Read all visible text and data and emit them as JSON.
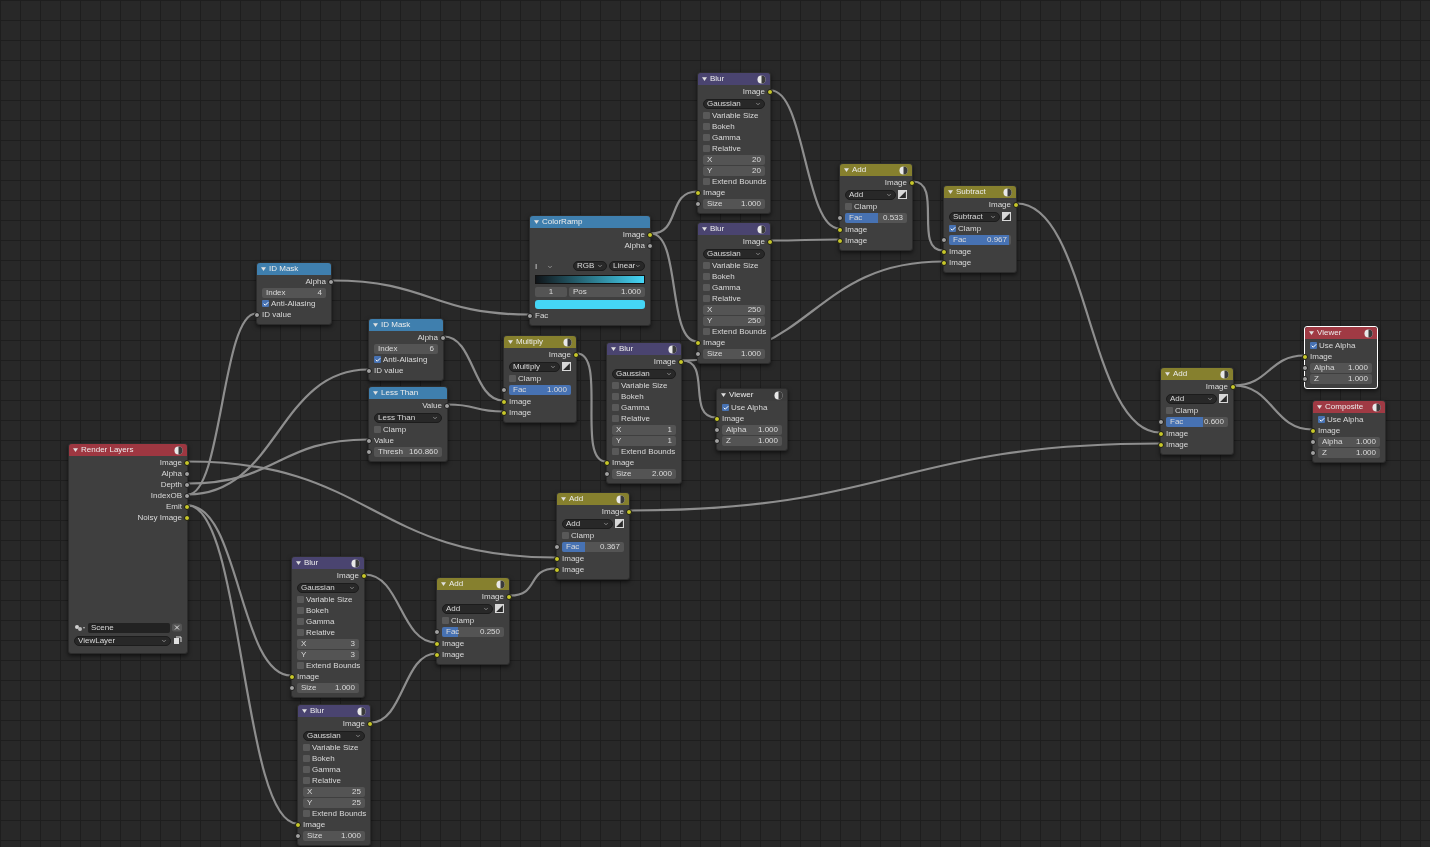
{
  "nodes": [
    {
      "title": "Render Layers",
      "kind": "input",
      "selected": false,
      "preview_icon": true,
      "rows": [
        {
          "kind": "output",
          "label": "Image",
          "socket": {
            "kind": "color"
          }
        },
        {
          "kind": "output",
          "label": "Alpha",
          "socket": {
            "kind": "value"
          }
        },
        {
          "kind": "output",
          "label": "Depth",
          "socket": {
            "kind": "value"
          }
        },
        {
          "kind": "output",
          "label": "IndexOB",
          "socket": {
            "kind": "value"
          }
        },
        {
          "kind": "output",
          "label": "Emit",
          "socket": {
            "kind": "color"
          }
        },
        {
          "kind": "output",
          "label": "Noisy Image",
          "socket": {
            "kind": "color"
          }
        },
        {
          "kind": "scene",
          "value": "Scene"
        },
        {
          "kind": "layer",
          "value": "ViewLayer"
        }
      ]
    },
    {
      "title": "ID Mask",
      "kind": "matte",
      "selected": false,
      "preview_icon": false,
      "rows": [
        {
          "kind": "output",
          "label": "Alpha",
          "socket": {
            "kind": "value"
          }
        },
        {
          "kind": "field",
          "label": "Index",
          "value": "4"
        },
        {
          "kind": "checkbox",
          "label": "Anti-Aliasing",
          "checked": true
        },
        {
          "kind": "input",
          "label": "ID value",
          "socket": {
            "kind": "value"
          }
        }
      ]
    },
    {
      "title": "Blur",
      "kind": "filter",
      "selected": false,
      "preview_icon": true,
      "rows": [
        {
          "kind": "output",
          "label": "Image",
          "socket": {
            "kind": "color"
          }
        },
        {
          "kind": "select",
          "value": "Gaussian"
        },
        {
          "kind": "checkbox",
          "label": "Variable Size",
          "checked": false
        },
        {
          "kind": "checkbox",
          "label": "Bokeh",
          "checked": false
        },
        {
          "kind": "checkbox",
          "label": "Gamma",
          "checked": false
        },
        {
          "kind": "checkbox",
          "label": "Relative",
          "checked": false
        },
        {
          "kind": "field",
          "label": "X",
          "value": "3"
        },
        {
          "kind": "field",
          "label": "Y",
          "value": "3"
        },
        {
          "kind": "checkbox",
          "label": "Extend Bounds",
          "checked": false
        },
        {
          "kind": "input",
          "label": "Image",
          "socket": {
            "kind": "color"
          }
        },
        {
          "kind": "field",
          "label": "Size",
          "value": "1.000",
          "socket": {
            "kind": "value"
          }
        }
      ]
    },
    {
      "title": "Blur",
      "kind": "filter",
      "selected": false,
      "preview_icon": true,
      "rows": [
        {
          "kind": "output",
          "label": "Image",
          "socket": {
            "kind": "color"
          }
        },
        {
          "kind": "select",
          "value": "Gaussian"
        },
        {
          "kind": "checkbox",
          "label": "Variable Size",
          "checked": false
        },
        {
          "kind": "checkbox",
          "label": "Bokeh",
          "checked": false
        },
        {
          "kind": "checkbox",
          "label": "Gamma",
          "checked": false
        },
        {
          "kind": "checkbox",
          "label": "Relative",
          "checked": false
        },
        {
          "kind": "field",
          "label": "X",
          "value": "25"
        },
        {
          "kind": "field",
          "label": "Y",
          "value": "25"
        },
        {
          "kind": "checkbox",
          "label": "Extend Bounds",
          "checked": false
        },
        {
          "kind": "input",
          "label": "Image",
          "socket": {
            "kind": "color"
          }
        },
        {
          "kind": "field",
          "label": "Size",
          "value": "1.000",
          "socket": {
            "kind": "value"
          }
        }
      ]
    },
    {
      "title": "ID Mask",
      "kind": "matte",
      "selected": false,
      "preview_icon": false,
      "rows": [
        {
          "kind": "output",
          "label": "Alpha",
          "socket": {
            "kind": "value"
          }
        },
        {
          "kind": "field",
          "label": "Index",
          "value": "6"
        },
        {
          "kind": "checkbox",
          "label": "Anti-Aliasing",
          "checked": true
        },
        {
          "kind": "input",
          "label": "ID value",
          "socket": {
            "kind": "value"
          }
        }
      ]
    },
    {
      "title": "Less Than",
      "kind": "converter",
      "selected": false,
      "preview_icon": false,
      "rows": [
        {
          "kind": "output",
          "label": "Value",
          "socket": {
            "kind": "value"
          }
        },
        {
          "kind": "select",
          "value": "Less Than"
        },
        {
          "kind": "checkbox",
          "label": "Clamp",
          "checked": false
        },
        {
          "kind": "input",
          "label": "Value",
          "socket": {
            "kind": "value"
          }
        },
        {
          "kind": "field",
          "label": "Thresh",
          "value": "160.860",
          "socket": {
            "kind": "value"
          }
        }
      ]
    },
    {
      "title": "Add",
      "kind": "color",
      "selected": false,
      "preview_icon": true,
      "rows": [
        {
          "kind": "output",
          "label": "Image",
          "socket": {
            "kind": "color"
          }
        },
        {
          "kind": "mix_select",
          "value": "Add"
        },
        {
          "kind": "checkbox",
          "label": "Clamp",
          "checked": false
        },
        {
          "kind": "slider",
          "label": "Fac",
          "value": "0.250",
          "level": 0.25,
          "socket": {
            "kind": "value"
          }
        },
        {
          "kind": "input",
          "label": "Image",
          "socket": {
            "kind": "color"
          }
        },
        {
          "kind": "input",
          "label": "Image",
          "socket": {
            "kind": "color"
          }
        }
      ]
    },
    {
      "title": "Multiply",
      "kind": "color",
      "selected": false,
      "preview_icon": true,
      "rows": [
        {
          "kind": "output",
          "label": "Image",
          "socket": {
            "kind": "color"
          }
        },
        {
          "kind": "mix_select",
          "value": "Multiply"
        },
        {
          "kind": "checkbox",
          "label": "Clamp",
          "checked": false
        },
        {
          "kind": "slider",
          "label": "Fac",
          "value": "1.000",
          "level": 1,
          "socket": {
            "kind": "value"
          }
        },
        {
          "kind": "input",
          "label": "Image",
          "socket": {
            "kind": "color"
          }
        },
        {
          "kind": "input",
          "label": "Image",
          "socket": {
            "kind": "color"
          }
        }
      ]
    },
    {
      "title": "ColorRamp",
      "kind": "converter",
      "selected": false,
      "preview_icon": false,
      "rows": [
        {
          "kind": "output",
          "label": "Image",
          "socket": {
            "kind": "color"
          }
        },
        {
          "kind": "output",
          "label": "Alpha",
          "socket": {
            "kind": "value"
          }
        },
        {
          "kind": "ramp_tools",
          "text": "I",
          "color_mode": "RGB",
          "interpolation": "Linear"
        },
        {
          "kind": "ramp"
        },
        {
          "kind": "stop_fields",
          "index": "1",
          "label": "Pos",
          "value": "1.000"
        },
        {
          "kind": "swatch",
          "color": "#45d6f6"
        },
        {
          "kind": "input",
          "label": "Fac",
          "socket": {
            "kind": "value"
          }
        }
      ]
    },
    {
      "title": "Add",
      "kind": "color",
      "selected": false,
      "preview_icon": true,
      "rows": [
        {
          "kind": "output",
          "label": "Image",
          "socket": {
            "kind": "color"
          }
        },
        {
          "kind": "mix_select",
          "value": "Add"
        },
        {
          "kind": "checkbox",
          "label": "Clamp",
          "checked": false
        },
        {
          "kind": "slider",
          "label": "Fac",
          "value": "0.367",
          "level": 0.367,
          "socket": {
            "kind": "value"
          }
        },
        {
          "kind": "input",
          "label": "Image",
          "socket": {
            "kind": "color"
          }
        },
        {
          "kind": "input",
          "label": "Image",
          "socket": {
            "kind": "color"
          }
        }
      ]
    },
    {
      "title": "Blur",
      "kind": "filter",
      "selected": false,
      "preview_icon": true,
      "rows": [
        {
          "kind": "output",
          "label": "Image",
          "socket": {
            "kind": "color"
          }
        },
        {
          "kind": "select",
          "value": "Gaussian"
        },
        {
          "kind": "checkbox",
          "label": "Variable Size",
          "checked": false
        },
        {
          "kind": "checkbox",
          "label": "Bokeh",
          "checked": false
        },
        {
          "kind": "checkbox",
          "label": "Gamma",
          "checked": false
        },
        {
          "kind": "checkbox",
          "label": "Relative",
          "checked": false
        },
        {
          "kind": "field",
          "label": "X",
          "value": "1"
        },
        {
          "kind": "field",
          "label": "Y",
          "value": "1"
        },
        {
          "kind": "checkbox",
          "label": "Extend Bounds",
          "checked": false
        },
        {
          "kind": "input",
          "label": "Image",
          "socket": {
            "kind": "color"
          }
        },
        {
          "kind": "field",
          "label": "Size",
          "value": "2.000",
          "socket": {
            "kind": "value"
          }
        }
      ]
    },
    {
      "title": "Blur",
      "kind": "filter",
      "selected": false,
      "preview_icon": true,
      "rows": [
        {
          "kind": "output",
          "label": "Image",
          "socket": {
            "kind": "color"
          }
        },
        {
          "kind": "select",
          "value": "Gaussian"
        },
        {
          "kind": "checkbox",
          "label": "Variable Size",
          "checked": false
        },
        {
          "kind": "checkbox",
          "label": "Bokeh",
          "checked": false
        },
        {
          "kind": "checkbox",
          "label": "Gamma",
          "checked": false
        },
        {
          "kind": "checkbox",
          "label": "Relative",
          "checked": false
        },
        {
          "kind": "field",
          "label": "X",
          "value": "20"
        },
        {
          "kind": "field",
          "label": "Y",
          "value": "20"
        },
        {
          "kind": "checkbox",
          "label": "Extend Bounds",
          "checked": false
        },
        {
          "kind": "input",
          "label": "Image",
          "socket": {
            "kind": "color"
          }
        },
        {
          "kind": "field",
          "label": "Size",
          "value": "1.000",
          "socket": {
            "kind": "value"
          }
        }
      ]
    },
    {
      "title": "Blur",
      "kind": "filter",
      "selected": false,
      "preview_icon": true,
      "rows": [
        {
          "kind": "output",
          "label": "Image",
          "socket": {
            "kind": "color"
          }
        },
        {
          "kind": "select",
          "value": "Gaussian"
        },
        {
          "kind": "checkbox",
          "label": "Variable Size",
          "checked": false
        },
        {
          "kind": "checkbox",
          "label": "Bokeh",
          "checked": false
        },
        {
          "kind": "checkbox",
          "label": "Gamma",
          "checked": false
        },
        {
          "kind": "checkbox",
          "label": "Relative",
          "checked": false
        },
        {
          "kind": "field",
          "label": "X",
          "value": "250"
        },
        {
          "kind": "field",
          "label": "Y",
          "value": "250"
        },
        {
          "kind": "checkbox",
          "label": "Extend Bounds",
          "checked": false
        },
        {
          "kind": "input",
          "label": "Image",
          "socket": {
            "kind": "color"
          }
        },
        {
          "kind": "field",
          "label": "Size",
          "value": "1.000",
          "socket": {
            "kind": "value"
          }
        }
      ]
    },
    {
      "title": "Viewer",
      "kind": "output",
      "active": false,
      "selected": false,
      "preview_icon": true,
      "rows": [
        {
          "kind": "checkbox",
          "label": "Use Alpha",
          "checked": true
        },
        {
          "kind": "input",
          "label": "Image",
          "socket": {
            "kind": "color"
          }
        },
        {
          "kind": "field",
          "label": "Alpha",
          "value": "1.000",
          "socket": {
            "kind": "value"
          }
        },
        {
          "kind": "field",
          "label": "Z",
          "value": "1.000",
          "socket": {
            "kind": "value"
          }
        }
      ]
    },
    {
      "title": "Add",
      "kind": "color",
      "selected": false,
      "preview_icon": true,
      "rows": [
        {
          "kind": "output",
          "label": "Image",
          "socket": {
            "kind": "color"
          }
        },
        {
          "kind": "mix_select",
          "value": "Add"
        },
        {
          "kind": "checkbox",
          "label": "Clamp",
          "checked": false
        },
        {
          "kind": "slider",
          "label": "Fac",
          "value": "0.533",
          "level": 0.533,
          "socket": {
            "kind": "value"
          }
        },
        {
          "kind": "input",
          "label": "Image",
          "socket": {
            "kind": "color"
          }
        },
        {
          "kind": "input",
          "label": "Image",
          "socket": {
            "kind": "color"
          }
        }
      ]
    },
    {
      "title": "Subtract",
      "kind": "color",
      "selected": false,
      "preview_icon": true,
      "rows": [
        {
          "kind": "output",
          "label": "Image",
          "socket": {
            "kind": "color"
          }
        },
        {
          "kind": "mix_select",
          "value": "Subtract"
        },
        {
          "kind": "checkbox",
          "label": "Clamp",
          "checked": true
        },
        {
          "kind": "slider",
          "label": "Fac",
          "value": "0.967",
          "level": 0.967,
          "socket": {
            "kind": "value"
          }
        },
        {
          "kind": "input",
          "label": "Image",
          "socket": {
            "kind": "color"
          }
        },
        {
          "kind": "input",
          "label": "Image",
          "socket": {
            "kind": "color"
          }
        }
      ]
    },
    {
      "title": "Add",
      "kind": "color",
      "selected": false,
      "preview_icon": true,
      "rows": [
        {
          "kind": "output",
          "label": "Image",
          "socket": {
            "kind": "color"
          }
        },
        {
          "kind": "mix_select",
          "value": "Add"
        },
        {
          "kind": "checkbox",
          "label": "Clamp",
          "checked": false
        },
        {
          "kind": "slider",
          "label": "Fac",
          "value": "0.600",
          "level": 0.6,
          "socket": {
            "kind": "value"
          }
        },
        {
          "kind": "input",
          "label": "Image",
          "socket": {
            "kind": "color"
          }
        },
        {
          "kind": "input",
          "label": "Image",
          "socket": {
            "kind": "color"
          }
        }
      ]
    },
    {
      "title": "Viewer",
      "kind": "output",
      "active": true,
      "selected": true,
      "preview_icon": true,
      "rows": [
        {
          "kind": "checkbox",
          "label": "Use Alpha",
          "checked": true
        },
        {
          "kind": "input",
          "label": "Image",
          "socket": {
            "kind": "color"
          }
        },
        {
          "kind": "field",
          "label": "Alpha",
          "value": "1.000",
          "socket": {
            "kind": "value"
          }
        },
        {
          "kind": "field",
          "label": "Z",
          "value": "1.000",
          "socket": {
            "kind": "value"
          }
        }
      ]
    },
    {
      "title": "Composite",
      "kind": "output",
      "active": true,
      "selected": false,
      "preview_icon": true,
      "rows": [
        {
          "kind": "checkbox",
          "label": "Use Alpha",
          "checked": true
        },
        {
          "kind": "input",
          "label": "Image",
          "socket": {
            "kind": "color"
          }
        },
        {
          "kind": "field",
          "label": "Alpha",
          "value": "1.000",
          "socket": {
            "kind": "value"
          }
        },
        {
          "kind": "field",
          "label": "Z",
          "value": "1.000",
          "socket": {
            "kind": "value"
          }
        }
      ]
    }
  ]
}
